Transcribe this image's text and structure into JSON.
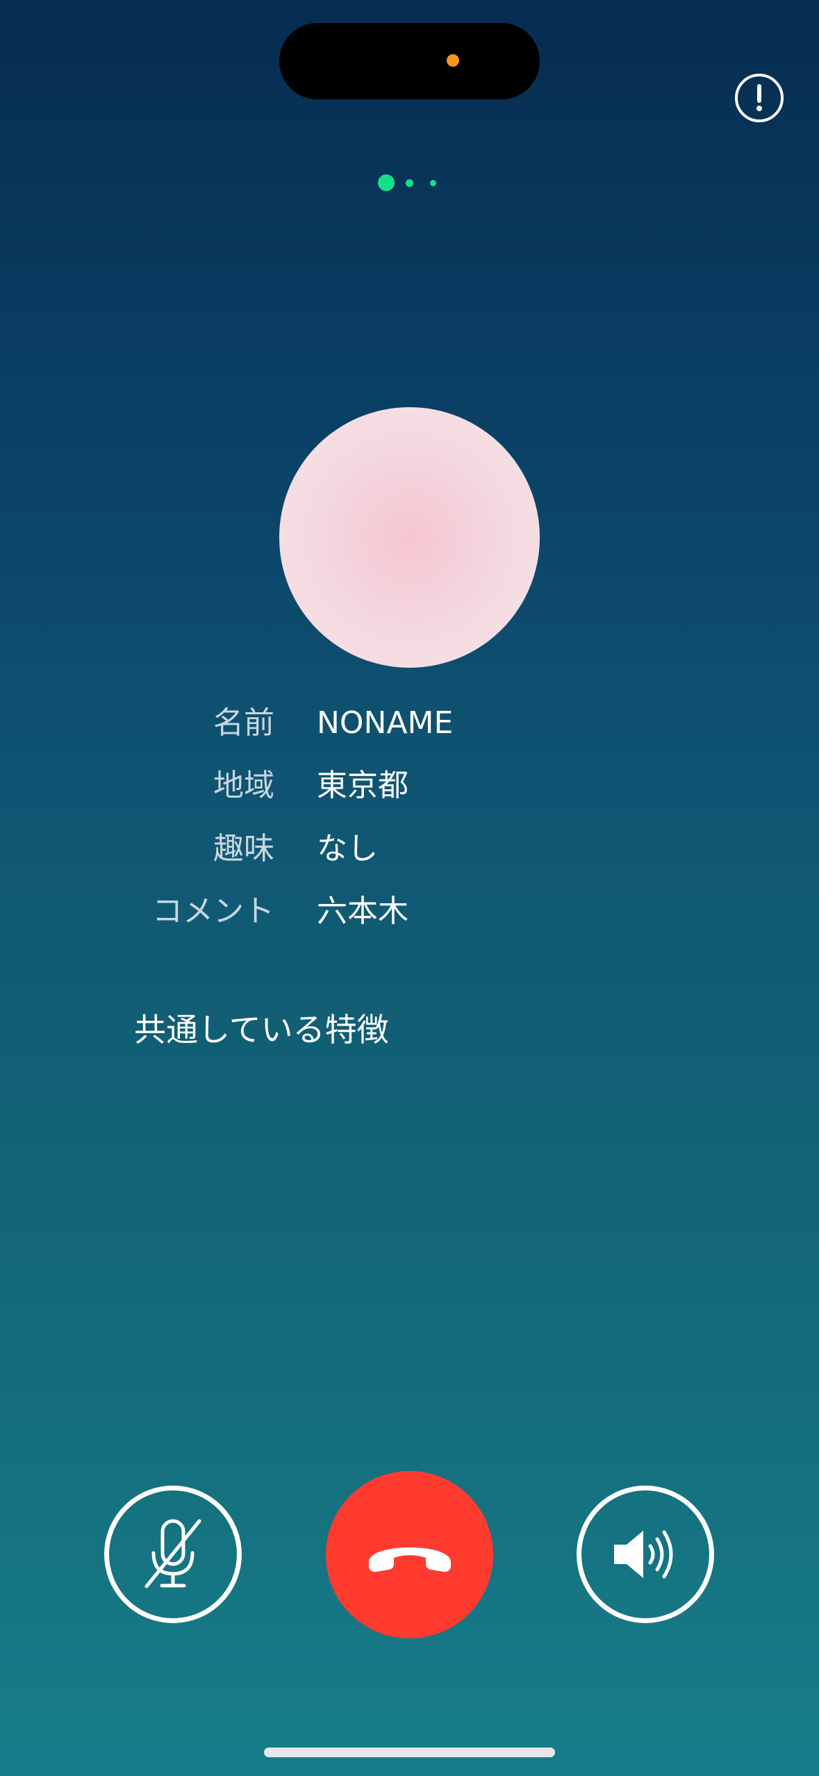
{
  "profile": {
    "rows": [
      {
        "label": "名前",
        "value": "NONAME"
      },
      {
        "label": "地域",
        "value": "東京都"
      },
      {
        "label": "趣味",
        "value": "なし"
      },
      {
        "label": "コメント",
        "value": "六本木"
      }
    ]
  },
  "common_features": {
    "heading": "共通している特徴"
  },
  "pager": {
    "count": 3,
    "active_index": 0
  },
  "controls": {
    "mute_icon": "microphone-slash-icon",
    "hangup_icon": "phone-down-icon",
    "speaker_icon": "speaker-wave-icon",
    "report_icon": "exclamation-circle-icon"
  },
  "colors": {
    "accent_green": "#15e08a",
    "hangup_red": "#ff3b30",
    "background_top": "#062c50",
    "background_bottom": "#177d8a",
    "avatar_pink": "#f5c6d2"
  }
}
